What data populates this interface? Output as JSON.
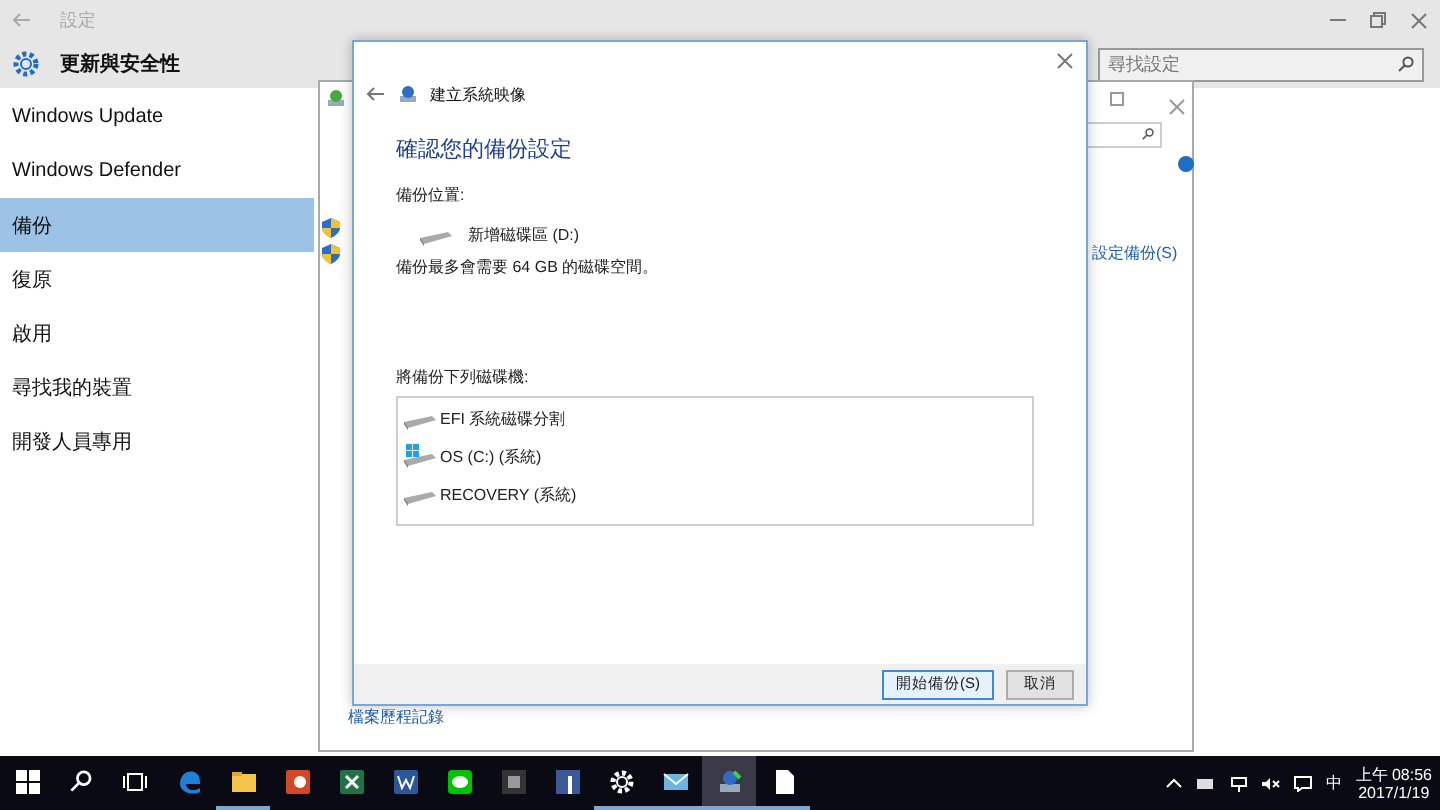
{
  "settings": {
    "title": "設定",
    "section": "更新與安全性",
    "search": {
      "placeholder": "尋找設定"
    },
    "nav": [
      {
        "label": "Windows Update",
        "selected": false
      },
      {
        "label": "Windows Defender",
        "selected": false
      },
      {
        "label": "備份",
        "selected": true
      },
      {
        "label": "復原",
        "selected": false
      },
      {
        "label": "啟用",
        "selected": false
      },
      {
        "label": "尋找我的裝置",
        "selected": false
      },
      {
        "label": "開發人員專用",
        "selected": false
      }
    ]
  },
  "control_panel": {
    "link": "設定備份(S)",
    "footer_link": "檔案歷程記錄"
  },
  "dialog": {
    "title": "建立系統映像",
    "heading": "確認您的備份設定",
    "location_label": "備份位置:",
    "location_drive": "新增磁碟區 (D:)",
    "space_note": "備份最多會需要 64 GB 的磁碟空間。",
    "drives_label": "將備份下列磁碟機:",
    "drives": [
      {
        "label": "EFI 系統磁碟分割",
        "kind": "plain"
      },
      {
        "label": "OS (C:) (系統)",
        "kind": "windows"
      },
      {
        "label": "RECOVERY (系統)",
        "kind": "plain"
      }
    ],
    "buttons": [
      {
        "label": "開始備份(S)",
        "selected": true
      },
      {
        "label": "取消",
        "selected": false
      }
    ]
  },
  "taskbar": {
    "apps": [
      {
        "kind": "edge",
        "running": false
      },
      {
        "kind": "folder",
        "running": true
      },
      {
        "kind": "slides",
        "running": false
      },
      {
        "kind": "sheet",
        "running": false
      },
      {
        "kind": "doc",
        "running": false
      },
      {
        "kind": "chat",
        "running": false
      },
      {
        "kind": "dark",
        "running": false
      },
      {
        "kind": "social",
        "running": false
      },
      {
        "kind": "gear",
        "running": true
      },
      {
        "kind": "mail",
        "running": true
      },
      {
        "kind": "backup",
        "running": true
      },
      {
        "kind": "file",
        "running": true
      }
    ],
    "ime": "中",
    "time": "上午 08:56",
    "date": "2017/1/19"
  }
}
